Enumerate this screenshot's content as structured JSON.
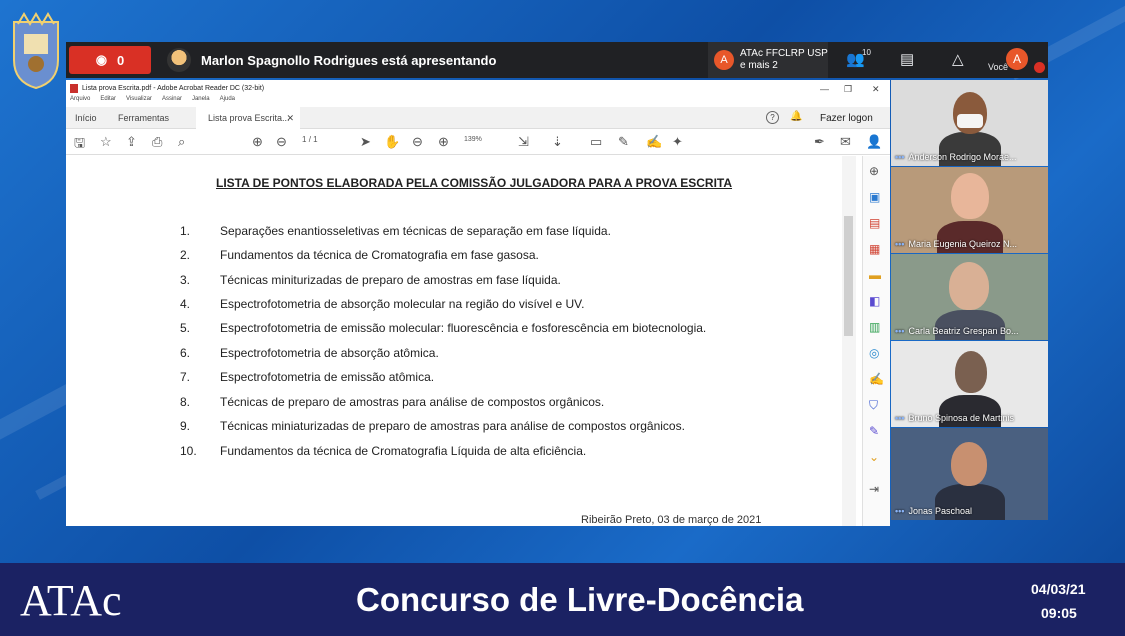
{
  "meet": {
    "viewer_count": "0",
    "presenter_text": "Marlon Spagnollo Rodrigues está apresentando",
    "host_initial": "A",
    "host_line1": "ATAc FFCLRP USP",
    "host_line2": "e mais 2",
    "people_count": "10",
    "self_label": "Você",
    "self_initial": "A"
  },
  "acrobat": {
    "window_title": "Lista prova Escrita.pdf - Adobe Acrobat Reader DC (32-bit)",
    "menu": [
      "Arquivo",
      "Editar",
      "Visualizar",
      "Assinar",
      "Janela",
      "Ajuda"
    ],
    "tabs": {
      "home": "Início",
      "tools": "Ferramentas",
      "document": "Lista prova Escrita..."
    },
    "login_label": "Fazer logon",
    "page_current": "1",
    "page_total": "/ 1",
    "zoom": "139%"
  },
  "document": {
    "title": "LISTA DE PONTOS ELABORADA PELA COMISSÃO JULGADORA PARA A PROVA ESCRITA",
    "items": [
      {
        "num": "1.",
        "text": "Separações enantiosseletivas em técnicas de separação em fase líquida."
      },
      {
        "num": "2.",
        "text": "Fundamentos da técnica de Cromatografia em fase gasosa."
      },
      {
        "num": "3.",
        "text": "Técnicas miniturizadas de preparo de amostras em fase líquida."
      },
      {
        "num": "4.",
        "text": "Espectrofotometria de absorção molecular na região do visível e UV."
      },
      {
        "num": "5.",
        "text": "Espectrofotometria de emissão molecular: fluorescência e fosforescência em biotecnologia."
      },
      {
        "num": "6.",
        "text": "Espectrofotometria de absorção atômica."
      },
      {
        "num": "7.",
        "text": "Espectrofotometria de emissão atômica."
      },
      {
        "num": "8.",
        "text": "Técnicas de preparo de amostras para análise de compostos orgânicos."
      },
      {
        "num": "9.",
        "text": "Técnicas miniaturizadas de preparo de amostras para análise de compostos orgânicos."
      },
      {
        "num": "10.",
        "text": "Fundamentos da técnica de Cromatografia Líquida de alta eficiência."
      }
    ],
    "footer": "Ribeirão Preto, 03 de março de 2021"
  },
  "participants": [
    {
      "name": "Anderson Rodrigo Morae...",
      "skin": "#8a5a3c",
      "bg": "#dcdcdc",
      "shirt": "#3a3a3a"
    },
    {
      "name": "Maria Eugenia Queiroz N...",
      "skin": "#e8b69a",
      "bg": "#b89a7a",
      "shirt": "#5a2a2a"
    },
    {
      "name": "Carla Beatriz Grespan Bo...",
      "skin": "#d9b095",
      "bg": "#8a9a8a",
      "shirt": "#4a5060"
    },
    {
      "name": "Bruno Spinosa de Martinis",
      "skin": "#7a6050",
      "bg": "#e8e8e8",
      "shirt": "#2a2a30"
    },
    {
      "name": "Jonas Paschoal",
      "skin": "#c89070",
      "bg": "#4a6080",
      "shirt": "#2a3040"
    }
  ],
  "banner": {
    "logo": "ATAc",
    "title": "Concurso de Livre-Docência",
    "date": "04/03/21",
    "time": "09:05"
  },
  "colors": {
    "banner_bg": "#1b2263",
    "meet_bar": "#202124",
    "alert_red": "#d93025"
  }
}
